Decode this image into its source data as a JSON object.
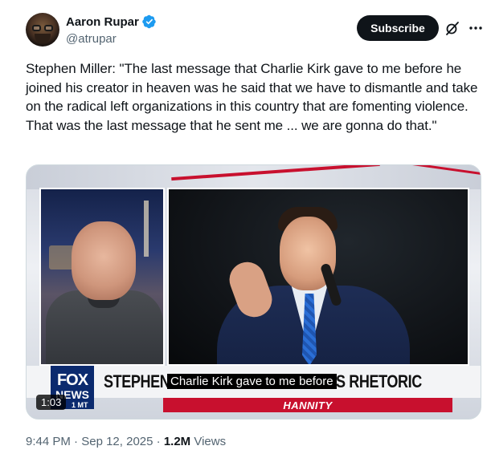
{
  "author": {
    "display_name": "Aaron Rupar",
    "handle": "@atrupar",
    "verified": true
  },
  "actions": {
    "subscribe_label": "Subscribe"
  },
  "icons": {
    "verified": "verified-badge-icon",
    "grok": "grok-icon",
    "more": "more-options-icon"
  },
  "tweet": {
    "text": "Stephen Miller: \"The last message that Charlie Kirk gave to me before he joined his creator in heaven was he said that we have to dismantle and take on the radical left organizations in this country that are fomenting violence. That was the last message that he sent me ... we are gonna do that.\""
  },
  "video": {
    "headline": "STEPHEN MILLER ON DANGEROUS RHETORIC",
    "caption": "Charlie Kirk gave to me before",
    "show_name": "HANNITY",
    "network_logo_top": "FOX",
    "network_logo_bottom": "NEWS",
    "time_zone": "1 MT",
    "duration": "1:03"
  },
  "meta": {
    "time": "9:44 PM",
    "separator": " · ",
    "date": "Sep 12, 2025",
    "views_count": "1.2M",
    "views_label": " Views"
  },
  "colors": {
    "accent_verified": "#1d9bf0",
    "subscribe_bg": "#0f1419",
    "text_secondary": "#536471",
    "fox_red": "#c8102e",
    "fox_blue": "#0b2a6e"
  }
}
